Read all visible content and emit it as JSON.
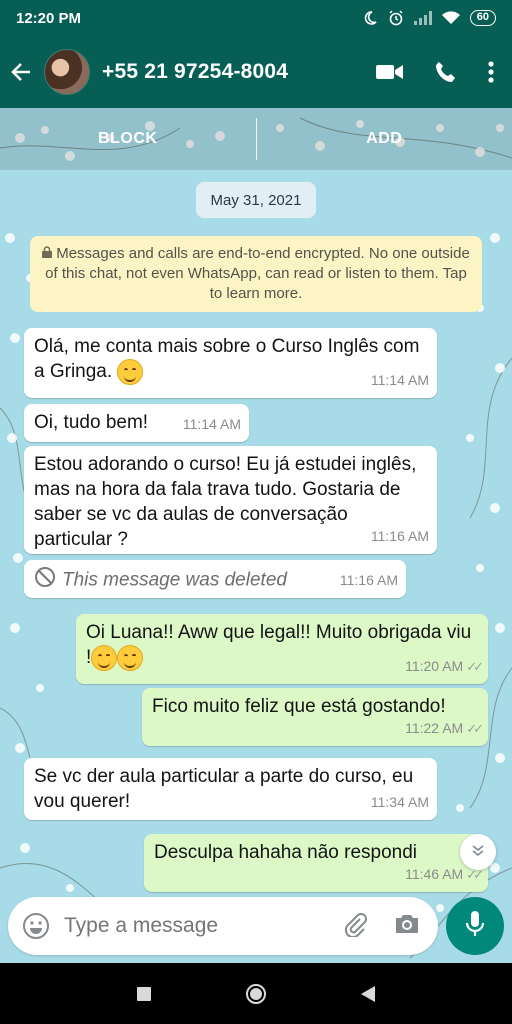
{
  "status": {
    "time": "12:20 PM",
    "battery": "60"
  },
  "header": {
    "contact": "+55 21 97254-8004"
  },
  "actions": {
    "block": "BLOCK",
    "add": "ADD"
  },
  "date_chip": "May 31, 2021",
  "encryption_notice": "Messages and calls are end-to-end encrypted. No one outside of this chat, not even WhatsApp, can read or listen to them. Tap to learn more.",
  "messages": [
    {
      "dir": "in",
      "text": "Olá, me conta mais sobre o Curso Inglês com a Gringa.",
      "time": "11:14 AM"
    },
    {
      "dir": "in",
      "text": "Oi, tudo bem!",
      "time": "11:14 AM"
    },
    {
      "dir": "in",
      "text": "Estou adorando o curso! Eu já estudei inglês, mas na hora da fala trava tudo. Gostaria de saber se vc da aulas de conversação particular ?",
      "time": "11:16 AM"
    },
    {
      "dir": "in",
      "deleted": true,
      "text": "This message was deleted",
      "time": "11:16 AM"
    },
    {
      "dir": "out",
      "text": "Oi Luana!! Aww que legal!! Muito obrigada viu !",
      "time": "11:20 AM"
    },
    {
      "dir": "out",
      "text": "Fico muito feliz que está gostando!",
      "time": "11:22 AM"
    },
    {
      "dir": "in",
      "text": "Se vc der aula particular a parte do curso, eu vou querer!",
      "time": "11:34 AM"
    },
    {
      "dir": "out",
      "text": "Desculpa hahaha não respondi",
      "time": "11:46 AM"
    }
  ],
  "composer": {
    "placeholder": "Type a message"
  },
  "colors": {
    "header": "#075e54",
    "outgoing": "#dcf8c6",
    "incoming": "#ffffff",
    "accent": "#00897b",
    "notice": "#fdf4c5"
  },
  "icons": [
    "moon-icon",
    "alarm-icon",
    "signal-icon",
    "wifi-icon",
    "back-arrow-icon",
    "video-call-icon",
    "phone-icon",
    "more-vert-icon",
    "lock-icon",
    "deleted-icon",
    "emoji-icon",
    "attach-icon",
    "camera-icon",
    "mic-icon",
    "chevron-down-icon",
    "nav-square-icon",
    "nav-circle-icon",
    "nav-triangle-icon"
  ]
}
